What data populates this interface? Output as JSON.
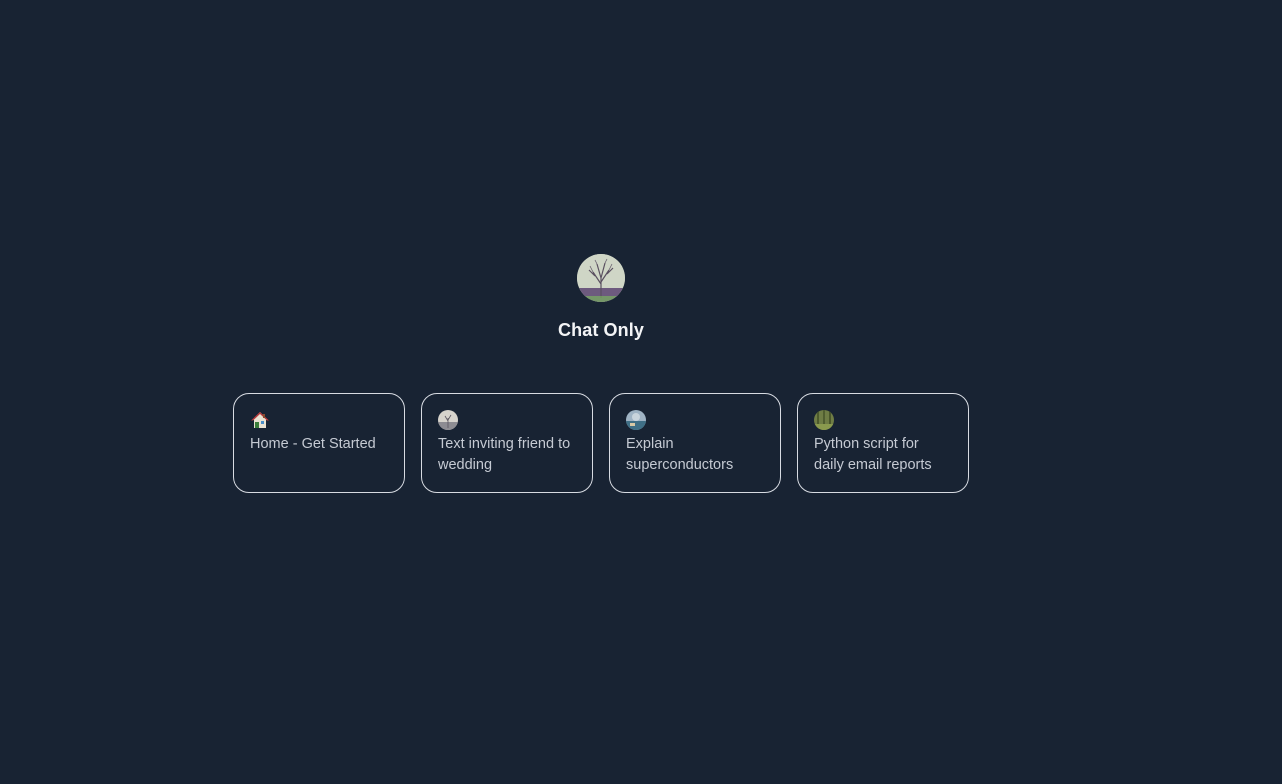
{
  "assistant": {
    "name": "Chat Only",
    "avatar_icon": "tree-avatar-icon"
  },
  "suggestions": [
    {
      "label": "Home - Get Started",
      "icon": "house-icon"
    },
    {
      "label": "Text inviting friend to wedding",
      "icon": "image-avatar-icon"
    },
    {
      "label": "Explain superconductors",
      "icon": "image-avatar-icon"
    },
    {
      "label": "Python script for daily email reports",
      "icon": "image-avatar-icon"
    }
  ],
  "colors": {
    "background": "#182333",
    "title": "#f3f4f6",
    "card_border": "#d7dbe2",
    "card_text": "#c5cad3"
  }
}
